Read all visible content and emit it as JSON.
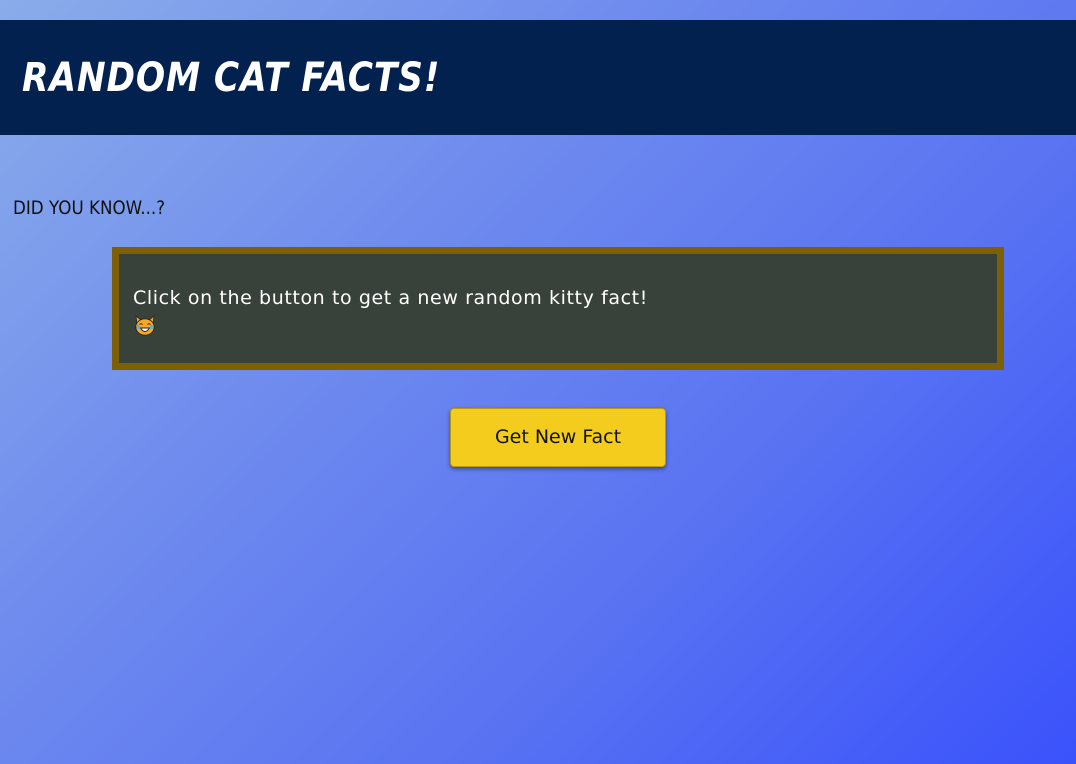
{
  "header": {
    "title": "RANDOM CAT FACTS!"
  },
  "main": {
    "heading": "DID YOU KNOW...?",
    "fact_text": "Click on the button to get a new random kitty fact!",
    "fact_icon": "cat-tears-of-joy-icon",
    "button_label": "Get New Fact"
  },
  "colors": {
    "header_bg": "#03214f",
    "fact_box_bg": "#39423a",
    "fact_box_border": "#7d6006",
    "button_bg": "#f3cc1d",
    "gradient_start": "#8aacea",
    "gradient_end": "#3a52fb"
  }
}
